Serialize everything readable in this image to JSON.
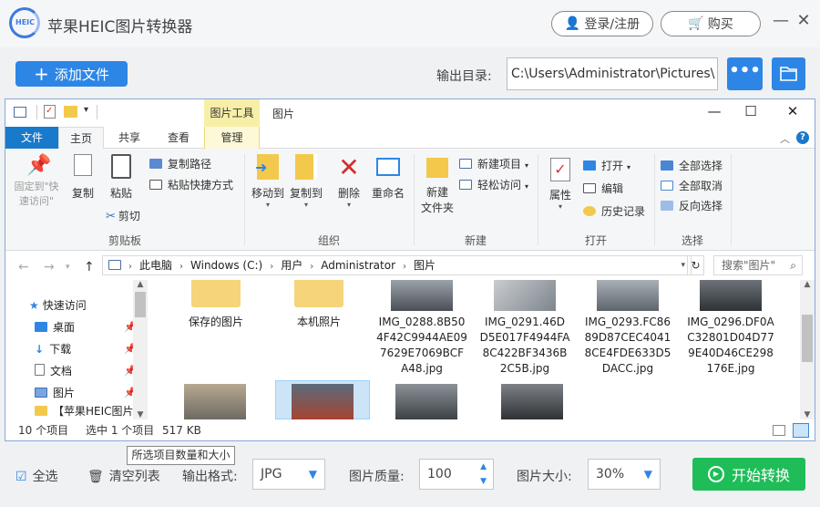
{
  "app": {
    "title": "苹果HEIC图片转换器",
    "logo_text": "HEIC",
    "login_label": "登录/注册",
    "buy_label": "购买"
  },
  "toolbar": {
    "add_files_label": "添加文件",
    "output_dir_label": "输出目录:",
    "output_dir_value": "C:\\Users\\Administrator\\Pictures\\",
    "more_label": "•••"
  },
  "explorer": {
    "context_tab": "图片工具",
    "window_title": "图片",
    "tabs": [
      "文件",
      "主页",
      "共享",
      "查看",
      "管理"
    ],
    "ribbon": {
      "pin_label": "固定到\"快速访问\"",
      "copy": "复制",
      "paste": "粘贴",
      "copy_path": "复制路径",
      "paste_shortcut": "粘贴快捷方式",
      "cut": "剪切",
      "clipboard_group": "剪贴板",
      "move_to": "移动到",
      "copy_to": "复制到",
      "delete": "删除",
      "rename": "重命名",
      "organize_group": "组织",
      "new_folder": "新建\n文件夹",
      "new_item": "新建项目",
      "easy_access": "轻松访问",
      "new_group": "新建",
      "properties": "属性",
      "open": "打开",
      "edit": "编辑",
      "history": "历史记录",
      "open_group": "打开",
      "select_all": "全部选择",
      "select_none": "全部取消",
      "invert_selection": "反向选择",
      "select_group": "选择"
    },
    "address": {
      "crumbs": [
        "此电脑",
        "Windows (C:)",
        "用户",
        "Administrator",
        "图片"
      ],
      "search_placeholder": "搜索\"图片\""
    },
    "nav": [
      {
        "label": "快速访问"
      },
      {
        "label": "桌面"
      },
      {
        "label": "下载"
      },
      {
        "label": "文档"
      },
      {
        "label": "图片"
      },
      {
        "label": "【苹果HEIC图片"
      }
    ],
    "files": [
      {
        "name": "保存的图片",
        "type": "folder"
      },
      {
        "name": "本机照片",
        "type": "folder"
      },
      {
        "name": "IMG_0288.8B504F42C9944AE097629E7069BCFA48.jpg",
        "type": "image",
        "lines": [
          "IMG_0288.8B50",
          "4F42C9944AE09",
          "7629E7069BCF",
          "A48.jpg"
        ]
      },
      {
        "name": "IMG_0291.46DD5E017F4944FA8C422BF3436B2C5B.jpg",
        "type": "image",
        "lines": [
          "IMG_0291.46D",
          "D5E017F4944FA",
          "8C422BF3436B",
          "2C5B.jpg"
        ]
      },
      {
        "name": "IMG_0293.FC8689D87CEC40418CE4FDE633D5DACC.jpg",
        "type": "image",
        "lines": [
          "IMG_0293.FC86",
          "89D87CEC4041",
          "8CE4FDE633D5",
          "DACC.jpg"
        ]
      },
      {
        "name": "IMG_0296.DF0AC32801D04D779E40D46CE298176E.jpg",
        "type": "image",
        "lines": [
          "IMG_0296.DF0A",
          "C32801D04D77",
          "9E40D46CE298",
          "176E.jpg"
        ]
      }
    ],
    "status": {
      "count": "10 个项目",
      "selected": "选中 1 个项目",
      "size": "517 KB"
    },
    "tooltip": "所选项目数量和大小"
  },
  "bottom": {
    "select_all": "全选",
    "clear_list": "清空列表",
    "format_label": "输出格式:",
    "format_value": "JPG",
    "quality_label": "图片质量:",
    "quality_value": "100",
    "size_label": "图片大小:",
    "size_value": "30%",
    "start_label": "开始转换"
  },
  "colors": {
    "accent": "#2d86e6",
    "start": "#1ebd58",
    "ribbon_file_tab": "#1979ca",
    "context_tab": "#f7efa8"
  }
}
